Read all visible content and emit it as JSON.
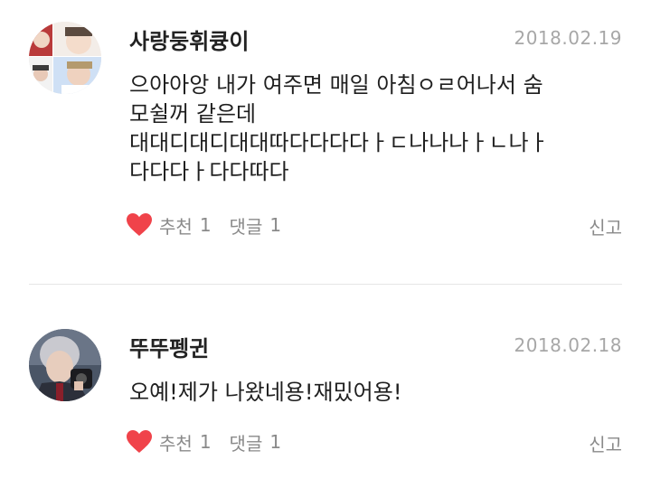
{
  "comments": [
    {
      "username": "사랑둥휘큥이",
      "date": "2018.02.19",
      "avatar_icon": "collage-photo-avatar",
      "lines": [
        "으아아앙 내가 여주면 매일 아침ㅇㄹ어나서 숨",
        "모쉴꺼 같은데",
        "대대디대디대대따다다다다ㅏㄷ나나나ㅏㄴ나ㅏ",
        "다다다ㅏ다다따다"
      ],
      "like_label": "추천",
      "like_count": "1",
      "reply_label": "댓글",
      "reply_count": "1",
      "report_label": "신고"
    },
    {
      "username": "뚜뚜펭귄",
      "date": "2018.02.18",
      "avatar_icon": "portrait-photo-avatar",
      "lines": [
        "오예!제가 나왔네용!재밌어용!"
      ],
      "like_label": "추천",
      "like_count": "1",
      "reply_label": "댓글",
      "reply_count": "1",
      "report_label": "신고"
    }
  ],
  "colors": {
    "heart": "#f0434a",
    "date": "#a7a7a7",
    "action_text": "#8a8a8a",
    "divider": "#e6e6e6"
  },
  "icons": {
    "like": "heart-icon"
  }
}
